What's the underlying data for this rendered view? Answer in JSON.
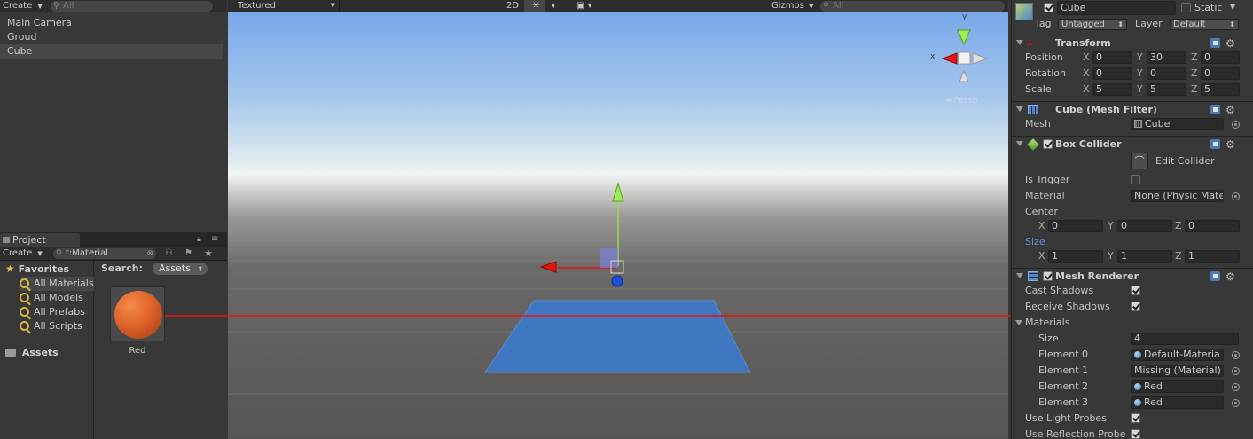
{
  "hierarchy": {
    "create_label": "Create",
    "search_placeholder": "All",
    "items": [
      "Main Camera",
      "Groud",
      "Cube"
    ]
  },
  "project": {
    "tab_label": "Project",
    "create_label": "Create",
    "search_value": "t:Material",
    "favorites_label": "Favorites",
    "favorites": [
      "All Materials",
      "All Models",
      "All Prefabs",
      "All Scripts"
    ],
    "assets_label": "Assets",
    "search_label": "Search:",
    "search_scope": "Assets",
    "asset_name": "Red"
  },
  "scene": {
    "shading_mode": "Textured",
    "mode_2d": "2D",
    "gizmos_label": "Gizmos",
    "search_placeholder": "All",
    "persp_label": "Persp",
    "axis_y": "y",
    "axis_x": "x"
  },
  "inspector": {
    "object_name": "Cube",
    "static_label": "Static",
    "tag_label": "Tag",
    "tag_value": "Untagged",
    "layer_label": "Layer",
    "layer_value": "Default",
    "transform": {
      "title": "Transform",
      "position_label": "Position",
      "rotation_label": "Rotation",
      "scale_label": "Scale",
      "position": [
        "0",
        "30",
        "0"
      ],
      "rotation": [
        "0",
        "0",
        "0"
      ],
      "scale": [
        "5",
        "5",
        "5"
      ]
    },
    "axis_labels": [
      "X",
      "Y",
      "Z"
    ],
    "mesh_filter": {
      "title": "Cube (Mesh Filter)",
      "mesh_label": "Mesh",
      "mesh_value": "Cube"
    },
    "box_collider": {
      "title": "Box Collider",
      "edit_label": "Edit Collider",
      "is_trigger_label": "Is Trigger",
      "material_label": "Material",
      "material_value": "None (Physic Mate",
      "center_label": "Center",
      "center": [
        "0",
        "0",
        "0"
      ],
      "size_label": "Size",
      "size": [
        "1",
        "1",
        "1"
      ]
    },
    "mesh_renderer": {
      "title": "Mesh Renderer",
      "cast_shadows_label": "Cast Shadows",
      "receive_shadows_label": "Receive Shadows",
      "materials_label": "Materials",
      "size_label": "Size",
      "size_value": "4",
      "elements": [
        {
          "label": "Element 0",
          "value": "Default-Materia"
        },
        {
          "label": "Element 1",
          "value": "Missing (Material)"
        },
        {
          "label": "Element 2",
          "value": "Red"
        },
        {
          "label": "Element 3",
          "value": "Red"
        }
      ],
      "light_probes_label": "Use Light Probes",
      "reflection_probes_label": "Use Reflection Probe"
    }
  },
  "colors": {
    "drag_arrow": "#e8120e",
    "ground_plane": "#3f78c0",
    "size_label_accent": "#5b8ee0",
    "material_orange": "#e0642a"
  }
}
